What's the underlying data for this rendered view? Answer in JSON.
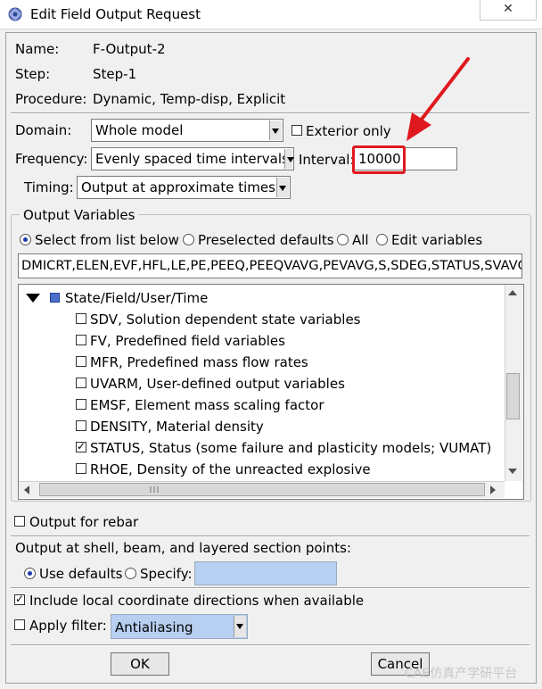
{
  "window": {
    "title": "Edit Field Output Request",
    "close_icon": "✕"
  },
  "info": {
    "name_label": "Name:",
    "name_value": "F-Output-2",
    "step_label": "Step:",
    "step_value": "Step-1",
    "procedure_label": "Procedure:",
    "procedure_value": "Dynamic, Temp-disp, Explicit"
  },
  "domain": {
    "label": "Domain:",
    "value": "Whole model",
    "exterior_only_label": "Exterior only",
    "exterior_only_checked": false
  },
  "frequency": {
    "label": "Frequency:",
    "value": "Evenly spaced time intervals",
    "interval_label": "Interval:",
    "interval_value": "10000"
  },
  "timing": {
    "label": "Timing:",
    "value": "Output at approximate times"
  },
  "output_variables": {
    "group_label": "Output Variables",
    "radios": [
      {
        "label": "Select from list below",
        "selected": true
      },
      {
        "label": "Preselected defaults",
        "selected": false
      },
      {
        "label": "All",
        "selected": false
      },
      {
        "label": "Edit variables",
        "selected": false
      }
    ],
    "variables_text": "DMICRT,ELEN,EVF,HFL,LE,PE,PEEQ,PEEQVAVG,PEVAVG,S,SDEG,STATUS,SVAVG",
    "tree_root": "State/Field/User/Time",
    "items": [
      {
        "label": "SDV, Solution dependent state variables",
        "checked": false
      },
      {
        "label": "FV, Predefined field variables",
        "checked": false
      },
      {
        "label": "MFR, Predefined mass flow rates",
        "checked": false
      },
      {
        "label": "UVARM, User-defined output variables",
        "checked": false
      },
      {
        "label": "EMSF, Element mass scaling factor",
        "checked": false
      },
      {
        "label": "DENSITY, Material density",
        "checked": false
      },
      {
        "label": "STATUS, Status (some failure and plasticity models; VUMAT)",
        "checked": true
      },
      {
        "label": "RHOE, Density of the unreacted explosive",
        "checked": false
      }
    ]
  },
  "rebar": {
    "label": "Output for rebar",
    "checked": false
  },
  "section_points": {
    "label": "Output at shell, beam, and layered section points:",
    "use_defaults_label": "Use defaults",
    "use_defaults_selected": true,
    "specify_label": "Specify:",
    "specify_value": ""
  },
  "local_coords": {
    "label": "Include local coordinate directions when available",
    "checked": true
  },
  "filter": {
    "label": "Apply filter:",
    "checked": false,
    "value": "Antialiasing"
  },
  "buttons": {
    "ok": "OK",
    "cancel": "Cancel"
  },
  "watermark": "CAE仿真产学研平台"
}
